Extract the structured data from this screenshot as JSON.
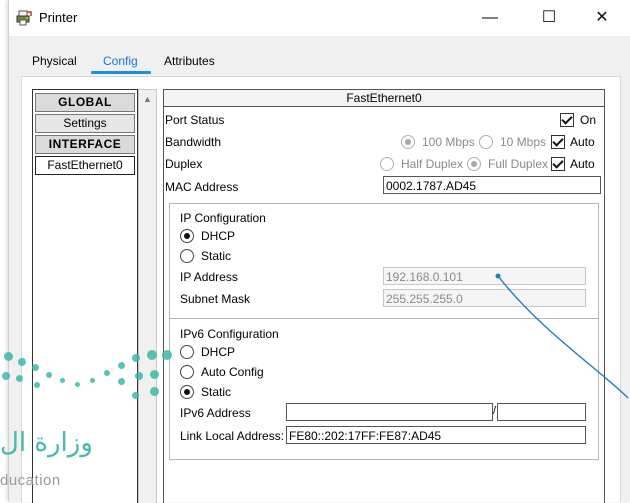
{
  "window": {
    "title": "Printer",
    "minimize": "—",
    "maximize": "☐",
    "close": "✕"
  },
  "tabs": [
    {
      "label": "Physical"
    },
    {
      "label": "Config"
    },
    {
      "label": "Attributes"
    }
  ],
  "nav": {
    "items": [
      {
        "label": "GLOBAL"
      },
      {
        "label": "Settings"
      },
      {
        "label": "INTERFACE"
      },
      {
        "label": "FastEthernet0"
      }
    ]
  },
  "panel": {
    "title": "FastEthernet0",
    "port_status": {
      "label": "Port Status",
      "on_label": "On",
      "checked": true
    },
    "bandwidth": {
      "label": "Bandwidth",
      "opt1": "100 Mbps",
      "opt2": "10 Mbps",
      "auto": "Auto"
    },
    "duplex": {
      "label": "Duplex",
      "opt1": "Half Duplex",
      "opt2": "Full Duplex",
      "auto": "Auto"
    },
    "mac": {
      "label": "MAC Address",
      "value": "0002.1787.AD45"
    },
    "ipv4": {
      "title": "IP Configuration",
      "dhcp": "DHCP",
      "static": "Static",
      "mode": "DHCP",
      "ip_label": "IP Address",
      "ip_value": "192.168.0.101",
      "mask_label": "Subnet Mask",
      "mask_value": "255.255.255.0"
    },
    "ipv6": {
      "title": "IPv6 Configuration",
      "dhcp": "DHCP",
      "auto": "Auto Config",
      "static": "Static",
      "mode": "Static",
      "addr_label": "IPv6 Address",
      "addr_value": "",
      "prefix_sep": "/",
      "prefix_value": "",
      "lla_label": "Link Local Address:",
      "lla_value": "FE80::202:17FF:FE87:AD45"
    }
  },
  "watermark": {
    "arabic": "وزارة ال",
    "latin": "ducation"
  },
  "colors": {
    "accent": "#1a73d9",
    "watermark": "#3bb7a6",
    "callout": "#1b7fc4"
  }
}
